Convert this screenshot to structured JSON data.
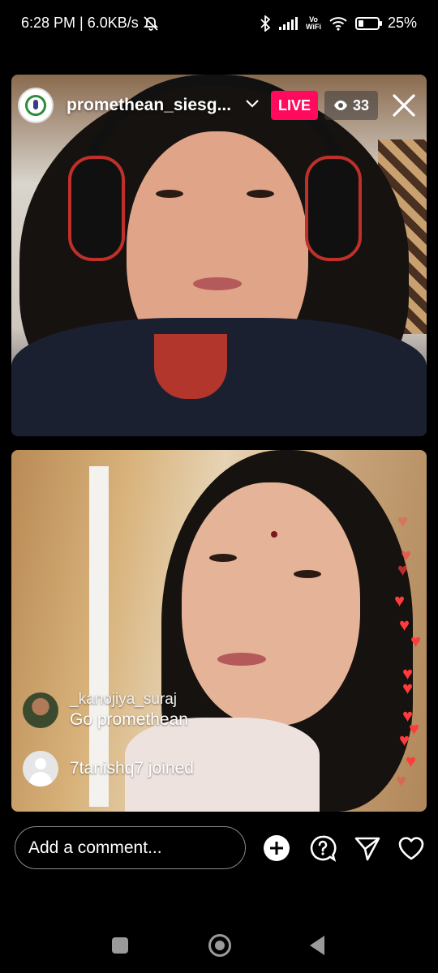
{
  "status_bar": {
    "time_speed": "6:28 PM | 6.0KB/s",
    "vowifi_line1": "Vo",
    "vowifi_line2": "WiFi",
    "battery": "25%",
    "battery_level": 0.25
  },
  "live": {
    "username": "promethean_siesg...",
    "live_label": "LIVE",
    "viewer_count": "33",
    "accent": "#ff0a5c"
  },
  "comments": [
    {
      "user": "_kanojiya_suraj",
      "text": "Go promethean"
    }
  ],
  "joined": {
    "text": "7tanishq7 joined"
  },
  "input": {
    "placeholder": "Add a comment..."
  },
  "icons": {
    "add": "plus-circle-icon",
    "question": "question-bubble-icon",
    "send": "paper-plane-icon",
    "like": "heart-icon"
  }
}
